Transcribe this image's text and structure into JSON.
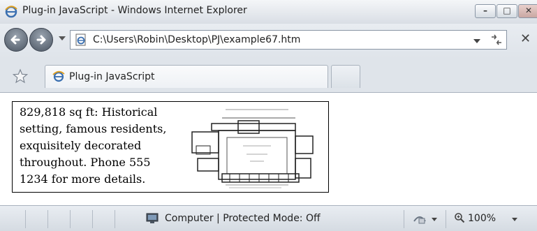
{
  "window": {
    "title": "Plug-in JavaScript - Windows Internet Explorer",
    "min_glyph": "–",
    "max_glyph": "□",
    "close_glyph": "✕"
  },
  "address_bar": {
    "url": "C:\\Users\\Robin\\Desktop\\PJ\\example67.htm",
    "refresh_glyph": "⁴⁄₇",
    "stop_glyph": "✕"
  },
  "tabs": [
    {
      "label": "Plug-in JavaScript",
      "active": true
    }
  ],
  "content": {
    "description": "829,818 sq ft: Historical setting, famous residents, exquisitely decorated throughout. Phone 555 1234 for more details."
  },
  "status_bar": {
    "zone": "Computer | Protected Mode: Off",
    "zoom": "100%"
  },
  "icons": {
    "browser": "ie-logo-icon",
    "favorites": "star-icon",
    "zone": "computer-icon",
    "security": "security-icon",
    "zoom": "magnifier-icon"
  },
  "colors": {
    "chrome": "#dfe3e8",
    "content_bg": "#ffffff"
  }
}
